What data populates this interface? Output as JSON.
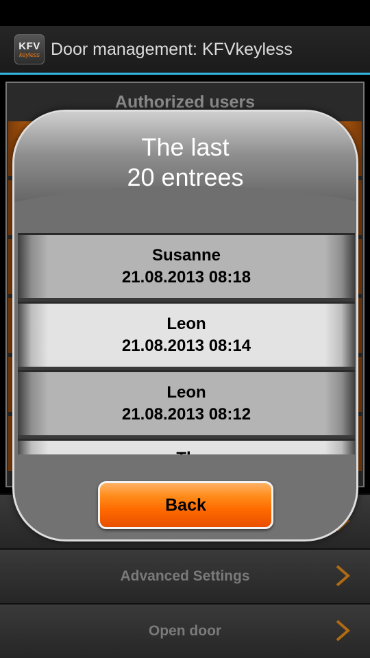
{
  "app": {
    "title": "Door management: KFVkeyless",
    "icon_text_top": "KFV",
    "icon_text_bottom": "keyless",
    "accent_color": "#33b5e5"
  },
  "background": {
    "heading": "Authorized users",
    "menu": [
      {
        "label": ""
      },
      {
        "label": "Advanced Settings"
      },
      {
        "label": "Open door"
      }
    ]
  },
  "dialog": {
    "title_line1": "The last",
    "title_line2": "20 entrees",
    "entries": [
      {
        "name": "Susanne",
        "datetime": "21.08.2013 08:18"
      },
      {
        "name": "Leon",
        "datetime": "21.08.2013 08:14"
      },
      {
        "name": "Leon",
        "datetime": "21.08.2013 08:12"
      },
      {
        "name": "Th",
        "datetime": ""
      }
    ],
    "back_label": "Back",
    "back_color": "#ff6a00"
  }
}
